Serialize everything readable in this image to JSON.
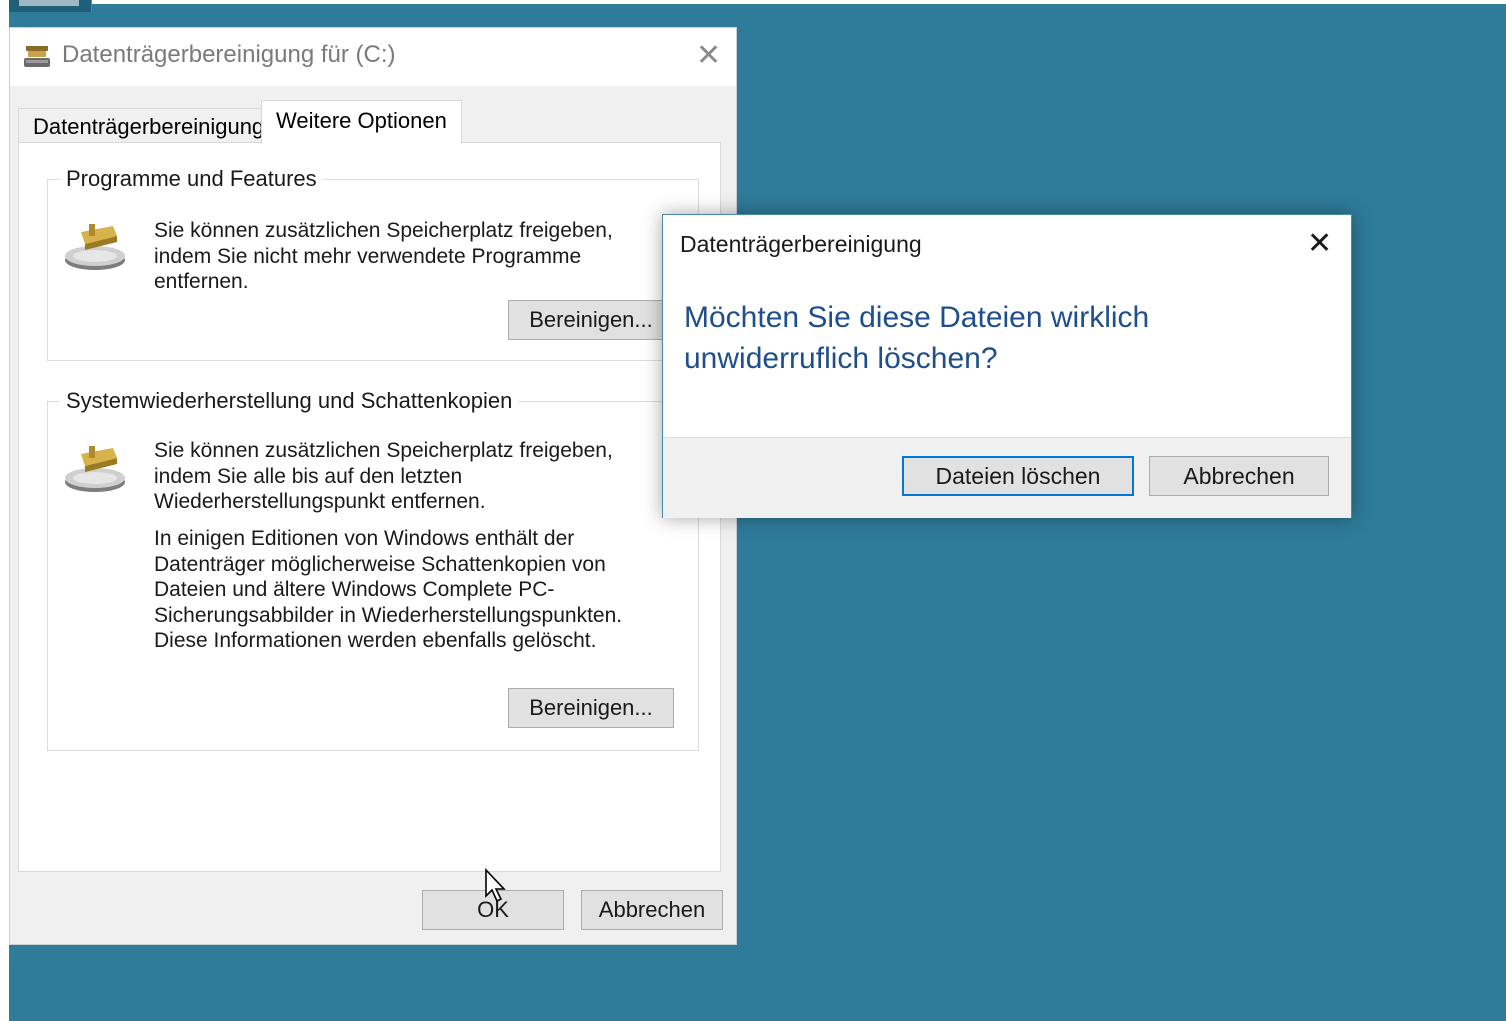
{
  "main_dialog": {
    "title": "Datenträgerbereinigung für  (C:)",
    "close_glyph": "✕",
    "tabs": [
      {
        "label": "Datenträgerbereinigung",
        "active": false
      },
      {
        "label": "Weitere Optionen",
        "active": true
      }
    ],
    "groups": [
      {
        "legend": "Programme und Features",
        "icon": "disk-cleanup-icon",
        "paragraphs": [
          "Sie können zusätzlichen Speicherplatz freigeben, indem Sie nicht mehr verwendete Programme entfernen."
        ],
        "button_label": "Bereinigen..."
      },
      {
        "legend": "Systemwiederherstellung und Schattenkopien",
        "icon": "disk-cleanup-icon",
        "paragraphs": [
          "Sie können zusätzlichen Speicherplatz freigeben, indem Sie alle bis auf den letzten Wiederherstellungspunkt entfernen.",
          "In einigen Editionen von Windows enthält der Datenträger möglicherweise Schattenkopien von Dateien und ältere Windows Complete PC-Sicherungsabbilder in Wiederherstellungspunkten. Diese Informationen werden ebenfalls gelöscht."
        ],
        "button_label": "Bereinigen..."
      }
    ],
    "ok_label": "OK",
    "cancel_label": "Abbrechen"
  },
  "confirm_dialog": {
    "title": "Datenträgerbereinigung",
    "close_glyph": "✕",
    "question": "Möchten Sie diese Dateien wirklich unwiderruflich löschen?",
    "delete_label": "Dateien löschen",
    "cancel_label": "Abbrechen"
  },
  "colors": {
    "desktop": "#2e7b9a",
    "question_text": "#1e4e8c",
    "default_button_border": "#0078d7"
  }
}
